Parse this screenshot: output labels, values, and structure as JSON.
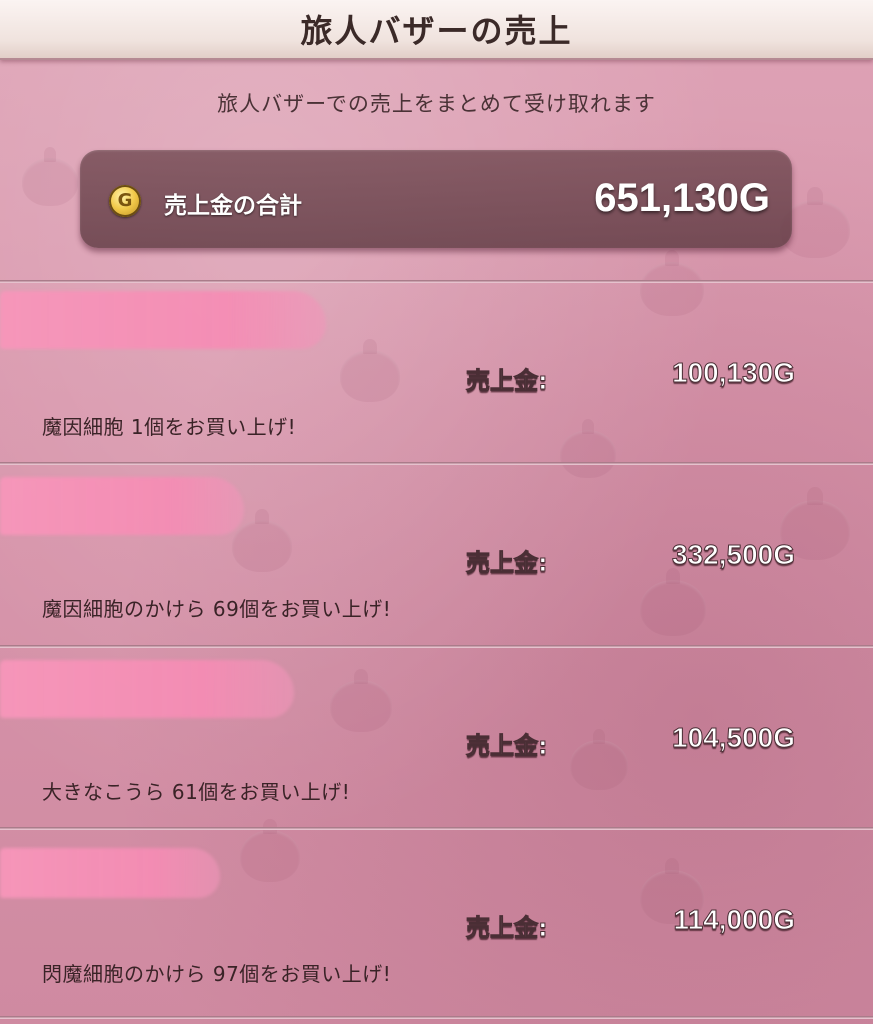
{
  "header": {
    "title": "旅人バザーの売上"
  },
  "subtitle": "旅人バザーでの売上をまとめて受け取れます",
  "total": {
    "coin_icon_letter": "G",
    "label": "売上金の合計",
    "value": "651,130G"
  },
  "sales": [
    {
      "label": "売上金:",
      "amount": "100,130G",
      "message": "魔因細胞  1個をお買い上げ!"
    },
    {
      "label": "売上金:",
      "amount": "332,500G",
      "message": "魔因細胞のかけら  69個をお買い上げ!"
    },
    {
      "label": "売上金:",
      "amount": "104,500G",
      "message": "大きなこうら  61個をお買い上げ!"
    },
    {
      "label": "売上金:",
      "amount": "114,000G",
      "message": "閃魔細胞のかけら  97個をお買い上げ!"
    }
  ],
  "colors": {
    "background": "#d895ab",
    "header_bg": "#f0e3de",
    "total_box": "#6e464e",
    "redaction": "#f58cb4",
    "coin": "#f2c94a"
  }
}
